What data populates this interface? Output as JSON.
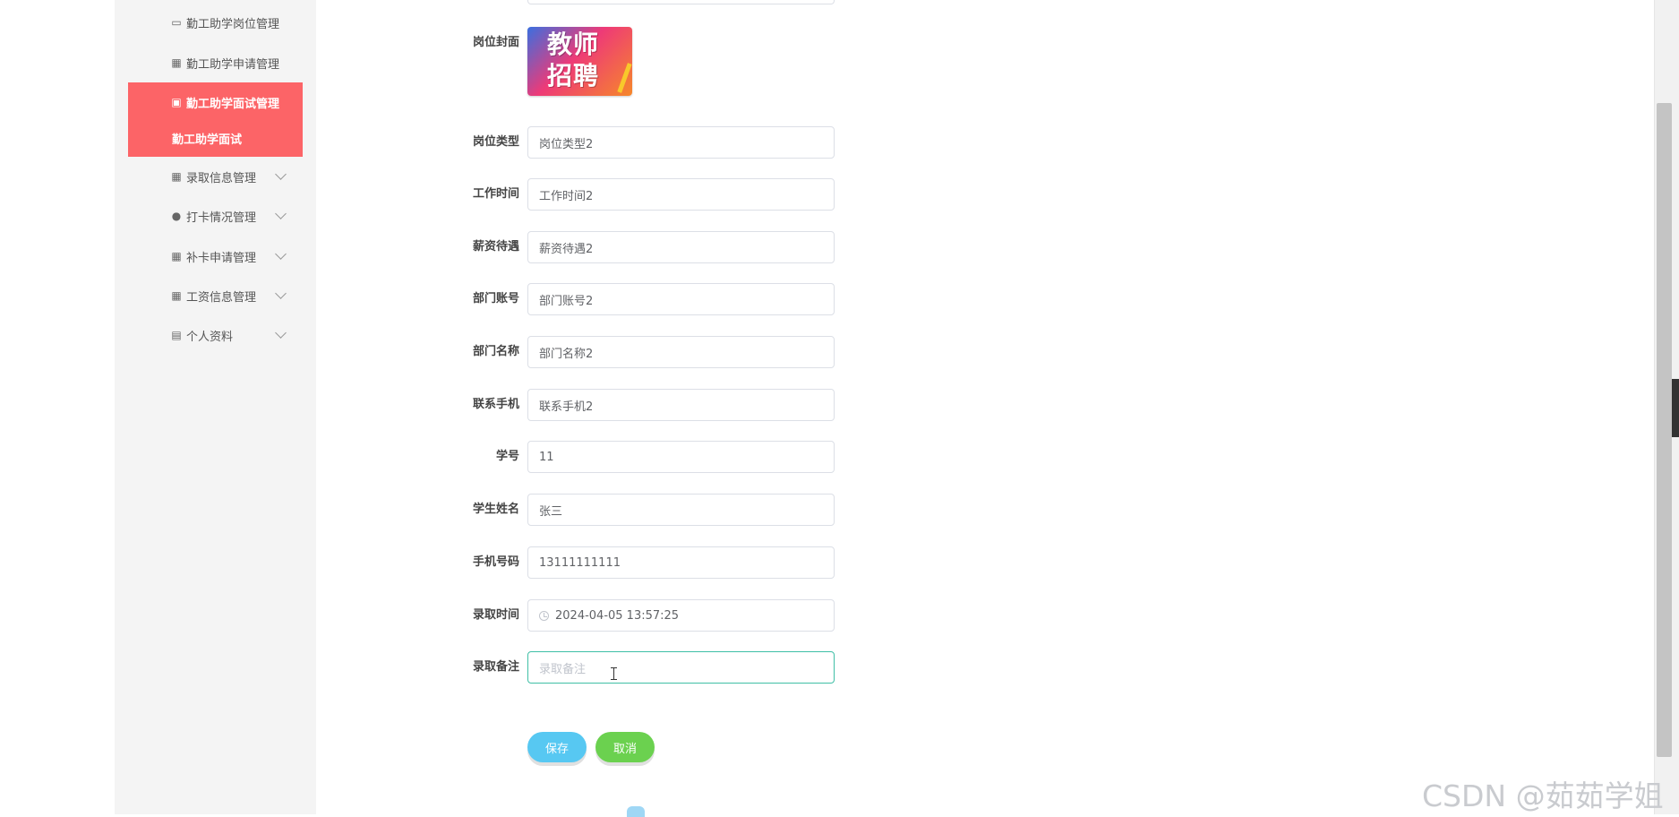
{
  "sidebar": {
    "items": [
      {
        "label": "勤工助学岗位管理",
        "icon": "clipboard-icon"
      },
      {
        "label": "勤工助学申请管理",
        "icon": "grid-icon"
      },
      {
        "label": "勤工助学面试管理",
        "icon": "chat-icon",
        "active": true
      },
      {
        "label": "录取信息管理",
        "icon": "grid-icon"
      },
      {
        "label": "打卡情况管理",
        "icon": "user-icon"
      },
      {
        "label": "补卡申请管理",
        "icon": "grid-icon"
      },
      {
        "label": "工资信息管理",
        "icon": "grid-icon"
      },
      {
        "label": "个人资料",
        "icon": "calendar-icon"
      }
    ],
    "sub_item": "勤工助学面试",
    "active_color": "#fc6467"
  },
  "form": {
    "cover_label": "岗位封面",
    "cover_text_line1": "教师",
    "cover_text_line2": "招聘",
    "fields": [
      {
        "label": "岗位类型",
        "value": "岗位类型2"
      },
      {
        "label": "工作时间",
        "value": "工作时间2"
      },
      {
        "label": "薪资待遇",
        "value": "薪资待遇2"
      },
      {
        "label": "部门账号",
        "value": "部门账号2"
      },
      {
        "label": "部门名称",
        "value": "部门名称2"
      },
      {
        "label": "联系手机",
        "value": "联系手机2"
      },
      {
        "label": "学号",
        "value": "11"
      },
      {
        "label": "学生姓名",
        "value": "张三"
      },
      {
        "label": "手机号码",
        "value": "13111111111"
      },
      {
        "label": "录取时间",
        "value": "2024-04-05 13:57:25"
      },
      {
        "label": "录取备注",
        "value": "",
        "placeholder": "录取备注"
      }
    ],
    "save_label": "保存",
    "cancel_label": "取消"
  },
  "watermark": "CSDN @茹茹学姐"
}
